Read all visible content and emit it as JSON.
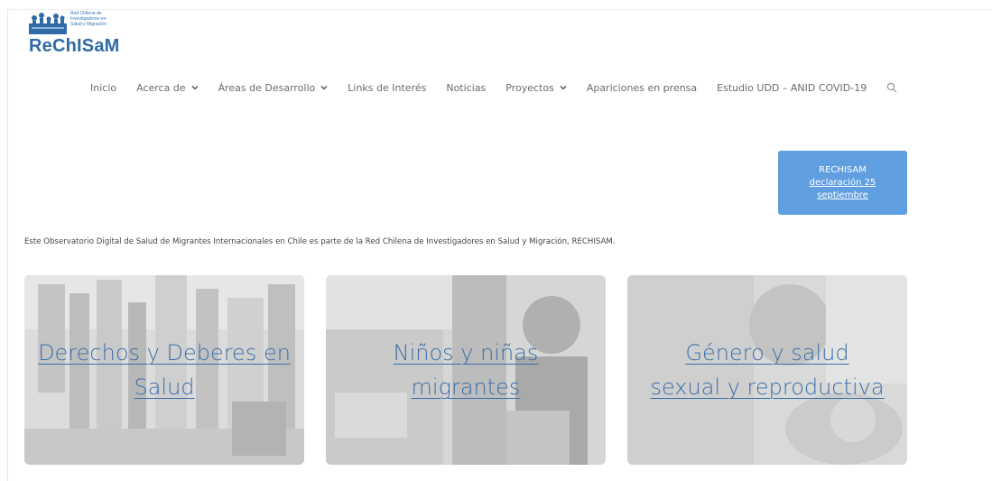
{
  "logo": {
    "tagline": [
      "Red Chilena de",
      "Investigadores en",
      "Salud y Migración"
    ],
    "name": "ReChISaM"
  },
  "nav": {
    "items": [
      {
        "label": "Inicio",
        "has_dropdown": false
      },
      {
        "label": "Acerca de",
        "has_dropdown": true
      },
      {
        "label": "Áreas de Desarrollo",
        "has_dropdown": true
      },
      {
        "label": "Links de Interés",
        "has_dropdown": false
      },
      {
        "label": "Noticias",
        "has_dropdown": false
      },
      {
        "label": "Proyectos",
        "has_dropdown": true
      },
      {
        "label": "Apariciones en prensa",
        "has_dropdown": false
      },
      {
        "label": "Estudio UDD – ANID COVID-19",
        "has_dropdown": false
      }
    ],
    "search_icon": "search-icon"
  },
  "cta": {
    "lines": [
      "RECHISAM",
      "declaración 25",
      "septiembre"
    ],
    "color": "#5f9fe0"
  },
  "intro": {
    "text": "Este Observatorio Digital de Salud de Migrantes Internacionales en Chile es parte de la Red Chilena de Investigadores en Salud y Migración, RECHISAM."
  },
  "cards": [
    {
      "lines": [
        "Derechos y Deberes en",
        "Salud"
      ]
    },
    {
      "lines": [
        "Niños y niñas",
        "migrantes"
      ]
    },
    {
      "lines": [
        "Género y salud",
        "sexual y reproductiva"
      ]
    }
  ],
  "colors": {
    "link_blue": "#3c6fa8",
    "brand_blue": "#2f6aa7"
  }
}
